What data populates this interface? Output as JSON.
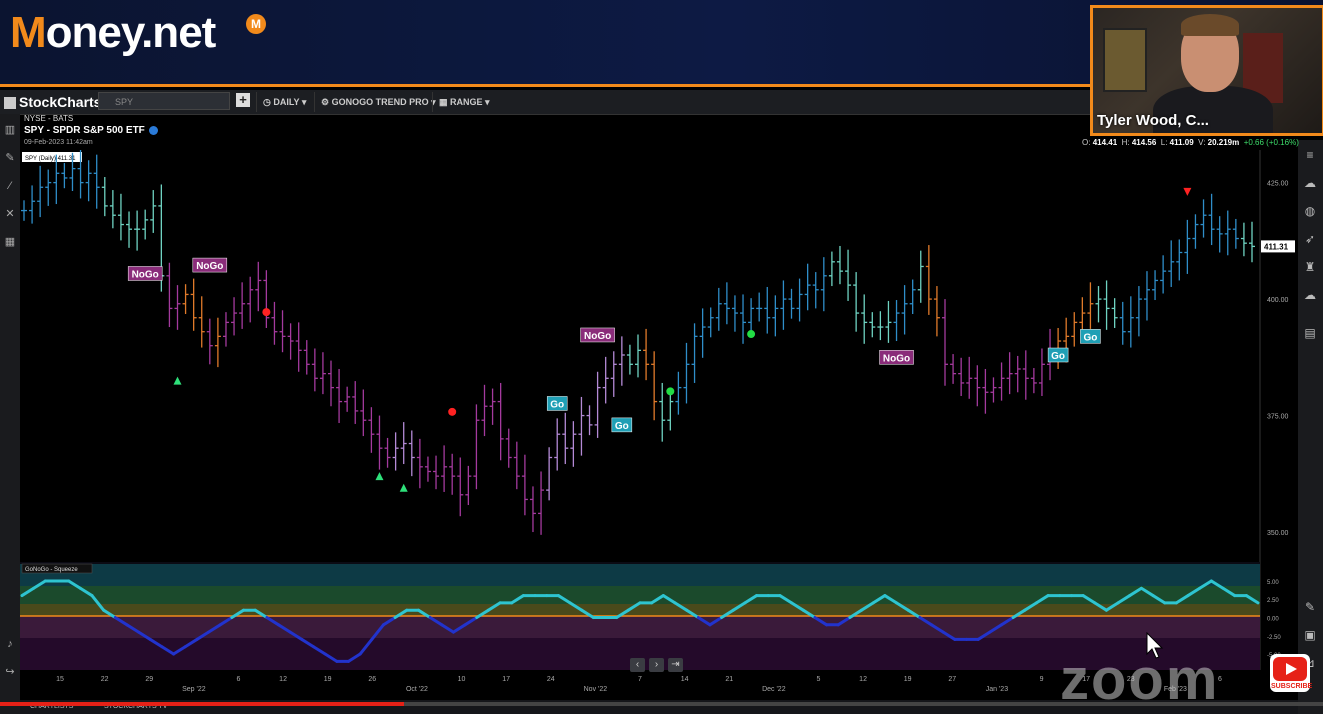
{
  "banner": {
    "logo_text_m": "M",
    "logo_text_rest": "oney.net",
    "logo_badge": "M"
  },
  "webcam": {
    "name": "Tyler Wood, C..."
  },
  "toolbar": {
    "brand": "StockCharts",
    "search_placeholder": "SPY",
    "period": "DAILY",
    "indicator": "GONOGO TREND PRO",
    "range": "RANGE"
  },
  "symbol": {
    "exchange": "NYSE - BATS",
    "title": "SPY - SPDR S&P 500 ETF",
    "timestamp": "09-Feb-2023 11:42am",
    "legend_tag": "SPY (Daily) 411.31"
  },
  "ohlc": {
    "o_label": "O:",
    "o": "414.41",
    "h_label": "H:",
    "h": "414.56",
    "l_label": "L:",
    "l": "411.09",
    "v_label": "V:",
    "v": "20.219m",
    "chg": "+0.66 (+0.16%)"
  },
  "lower_panel": {
    "title": "GoNoGo - Squeeze"
  },
  "zoom_watermark": "zoom",
  "subscribe": "SUBSCRIBE",
  "bottom_bar": {
    "chartlists": "CHARTLISTS",
    "stockcharts_tv": "STOCKCHARTS TV"
  },
  "progress_fraction": 0.305,
  "colors": {
    "accent": "#f28a1b",
    "go": "#1f9fb5",
    "nogo": "#8a2c7a",
    "up": "#3ddc6a",
    "down": "#ff2222"
  },
  "chart_data": {
    "type": "bar",
    "title": "SPY - SPDR S&P 500 ETF",
    "last_price": 411.31,
    "y_ticks": [
      425.0,
      400.0,
      375.0,
      350.0
    ],
    "ylim": [
      344,
      432
    ],
    "x_tick_labels": [
      "15",
      "22",
      "29",
      "Sep '22",
      "6",
      "12",
      "19",
      "26",
      "Oct '22",
      "10",
      "17",
      "24",
      "Nov '22",
      "7",
      "14",
      "21",
      "Dec '22",
      "5",
      "12",
      "19",
      "27",
      "Jan '23",
      "9",
      "17",
      "23",
      "Feb '23",
      "6"
    ],
    "closes": [
      419,
      421,
      424,
      425,
      427,
      426,
      428,
      425,
      427,
      424,
      420,
      418,
      416,
      415,
      415,
      417,
      420,
      405,
      398,
      399,
      401,
      396,
      393,
      390,
      392,
      395,
      397,
      399,
      402,
      404,
      396,
      393,
      392,
      391,
      389,
      386,
      383,
      384,
      381,
      378,
      379,
      376,
      374,
      371,
      368,
      366,
      368,
      369,
      366,
      364,
      363,
      362,
      364,
      362,
      358,
      362,
      374,
      377,
      378,
      370,
      366,
      362,
      357,
      354,
      359,
      366,
      371,
      368,
      371,
      375,
      373,
      381,
      383,
      386,
      388,
      386,
      389,
      386,
      378,
      374,
      378,
      381,
      386,
      392,
      394,
      396,
      399,
      398,
      397,
      395,
      398,
      398,
      396,
      398,
      400,
      398,
      401,
      403,
      402,
      405,
      408,
      406,
      403,
      397,
      395,
      394,
      394,
      395,
      397,
      399,
      402,
      407,
      400,
      396,
      386,
      384,
      382,
      383,
      381,
      380,
      381,
      383,
      384,
      385,
      383,
      382,
      386,
      389,
      391,
      392,
      395,
      397,
      399,
      400,
      398,
      396,
      393,
      396,
      400,
      402,
      404,
      406,
      408,
      410,
      413,
      416,
      418,
      415,
      414,
      415,
      413,
      412,
      411.31
    ],
    "bar_colors": [
      "b",
      "b",
      "b",
      "b",
      "b",
      "b",
      "b",
      "b",
      "b",
      "b",
      "t",
      "t",
      "t",
      "t",
      "t",
      "t",
      "t",
      "t",
      "p",
      "p",
      "o",
      "o",
      "o",
      "p",
      "o",
      "p",
      "p",
      "p",
      "p",
      "p",
      "p",
      "p",
      "p",
      "p",
      "p",
      "p",
      "p",
      "p",
      "p",
      "p",
      "p",
      "p",
      "p",
      "p",
      "p",
      "p",
      "l",
      "l",
      "l",
      "p",
      "p",
      "p",
      "p",
      "p",
      "p",
      "p",
      "p",
      "p",
      "p",
      "p",
      "p",
      "p",
      "p",
      "p",
      "p",
      "l",
      "l",
      "l",
      "l",
      "l",
      "l",
      "l",
      "l",
      "l",
      "l",
      "t",
      "t",
      "o",
      "o",
      "t",
      "t",
      "b",
      "b",
      "b",
      "b",
      "b",
      "b",
      "b",
      "b",
      "b",
      "b",
      "b",
      "b",
      "b",
      "b",
      "b",
      "b",
      "b",
      "b",
      "b",
      "t",
      "t",
      "t",
      "t",
      "t",
      "t",
      "t",
      "t",
      "b",
      "b",
      "b",
      "t",
      "o",
      "o",
      "p",
      "p",
      "p",
      "p",
      "p",
      "p",
      "p",
      "p",
      "p",
      "p",
      "p",
      "p",
      "p",
      "p",
      "o",
      "o",
      "o",
      "o",
      "o",
      "t",
      "t",
      "t",
      "b",
      "b",
      "b",
      "b",
      "b",
      "b",
      "b",
      "b",
      "b",
      "b",
      "b",
      "b",
      "b",
      "b",
      "b",
      "t",
      "t",
      "t",
      "t",
      "t"
    ],
    "labels": [
      {
        "text": "NoGo",
        "index": 15,
        "price": 405.5,
        "color": "nogo"
      },
      {
        "text": "NoGo",
        "index": 23,
        "price": 407.3,
        "color": "nogo"
      },
      {
        "text": "NoGo",
        "index": 71,
        "price": 392.3,
        "color": "nogo"
      },
      {
        "text": "NoGo",
        "index": 108,
        "price": 387.5,
        "color": "nogo"
      },
      {
        "text": "Go",
        "index": 66,
        "price": 377.6,
        "color": "go"
      },
      {
        "text": "Go",
        "index": 74,
        "price": 373.0,
        "color": "go"
      },
      {
        "text": "Go",
        "index": 128,
        "price": 388.0,
        "color": "go"
      },
      {
        "text": "Go",
        "index": 132,
        "price": 392.0,
        "color": "go"
      }
    ],
    "markers": [
      {
        "kind": "up-triangle",
        "index": 19,
        "price": 382.5
      },
      {
        "kind": "red-dot",
        "index": 30,
        "price": 397.2
      },
      {
        "kind": "up-triangle",
        "index": 44,
        "price": 362.0
      },
      {
        "kind": "up-triangle",
        "index": 47,
        "price": 359.5
      },
      {
        "kind": "red-dot",
        "index": 53,
        "price": 375.8
      },
      {
        "kind": "green-dot",
        "index": 80,
        "price": 380.2
      },
      {
        "kind": "green-dot",
        "index": 90,
        "price": 392.5
      },
      {
        "kind": "down-triangle",
        "index": 144,
        "price": 423.0
      }
    ],
    "oscillator": {
      "title": "GoNoGo - Squeeze",
      "y_ticks": [
        5.0,
        2.5,
        0,
        -2.5,
        -5.0
      ],
      "values": [
        3,
        4,
        5,
        5,
        5,
        4,
        3,
        1,
        0,
        -1,
        -2,
        -3,
        -4,
        -5,
        -4,
        -3,
        -2,
        -1,
        0,
        1,
        1,
        0,
        -1,
        -2,
        -3,
        -4,
        -5,
        -6,
        -6,
        -5,
        -3,
        -1,
        0,
        1,
        1,
        0,
        -1,
        -2,
        -1,
        0,
        1,
        2,
        2,
        3,
        3,
        3,
        3,
        2,
        1,
        0,
        0,
        0,
        1,
        2,
        2,
        3,
        2,
        1,
        0,
        -1,
        0,
        1,
        2,
        3,
        3,
        3,
        2,
        1,
        0,
        -1,
        -1,
        0,
        1,
        2,
        3,
        2,
        1,
        0,
        -1,
        -2,
        -3,
        -3,
        -3,
        -2,
        -1,
        0,
        1,
        2,
        3,
        3,
        3,
        3,
        2,
        1,
        2,
        3,
        4,
        3,
        2,
        2,
        3,
        4,
        5,
        4,
        3,
        3,
        2
      ]
    }
  }
}
